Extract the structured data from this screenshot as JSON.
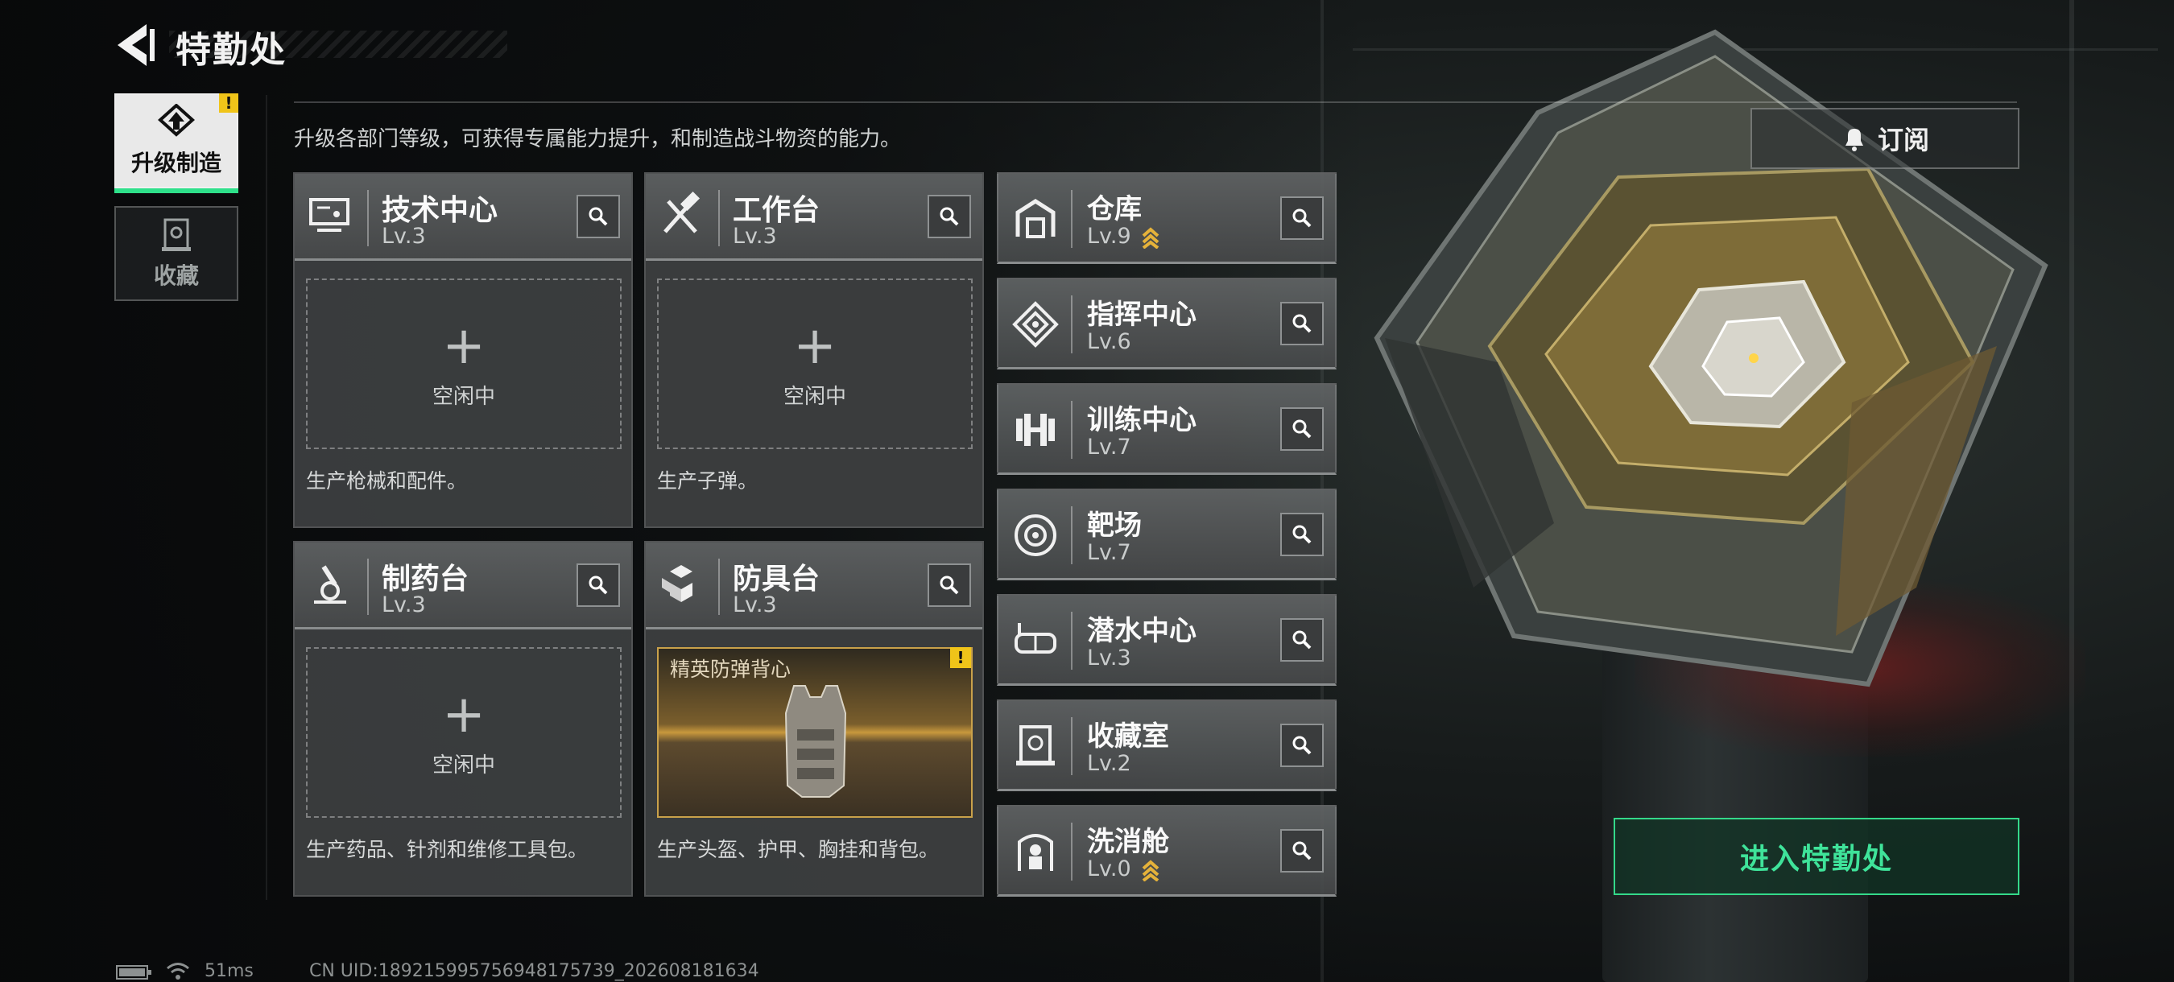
{
  "header": {
    "title": "特勤处",
    "subtitle": "升级各部门等级，可获得专属能力提升，和制造战斗物资的能力。"
  },
  "side_tabs": [
    {
      "label": "升级制造",
      "active": true,
      "alert": "!"
    },
    {
      "label": "收藏",
      "active": false
    }
  ],
  "facilities": [
    {
      "name": "技术中心",
      "level": "Lv.3",
      "slot_plus": "+",
      "slot_status": "空闲中",
      "desc": "生产枪械和配件。"
    },
    {
      "name": "工作台",
      "level": "Lv.3",
      "slot_plus": "+",
      "slot_status": "空闲中",
      "desc": "生产子弹。"
    },
    {
      "name": "制药台",
      "level": "Lv.3",
      "slot_plus": "+",
      "slot_status": "空闲中",
      "desc": "生产药品、针剂和维修工具包。"
    },
    {
      "name": "防具台",
      "level": "Lv.3",
      "slot_item": "精英防弹背心",
      "slot_alert": "!",
      "desc": "生产头盔、护甲、胸挂和背包。"
    }
  ],
  "departments": [
    {
      "name": "仓库",
      "level": "Lv.9",
      "upgradable": true,
      "icon": "warehouse-icon"
    },
    {
      "name": "指挥中心",
      "level": "Lv.6",
      "upgradable": false,
      "icon": "command-icon"
    },
    {
      "name": "训练中心",
      "level": "Lv.7",
      "upgradable": false,
      "icon": "dumbbell-icon"
    },
    {
      "name": "靶场",
      "level": "Lv.7",
      "upgradable": false,
      "icon": "target-icon"
    },
    {
      "name": "潜水中心",
      "level": "Lv.3",
      "upgradable": false,
      "icon": "diving-mask-icon"
    },
    {
      "name": "收藏室",
      "level": "Lv.2",
      "upgradable": false,
      "icon": "collection-icon"
    },
    {
      "name": "洗消舱",
      "level": "Lv.0",
      "upgradable": true,
      "icon": "decon-icon"
    }
  ],
  "subscribe_label": "订阅",
  "enter_label": "进入特勤处",
  "status": {
    "ping": "51ms",
    "uid": "CN UID:18921599575694817573​9_202608181634"
  },
  "colors": {
    "accent_green": "#34d98a",
    "alert_yellow": "#f0c419",
    "upgrade_gold": "#e5b23a"
  }
}
